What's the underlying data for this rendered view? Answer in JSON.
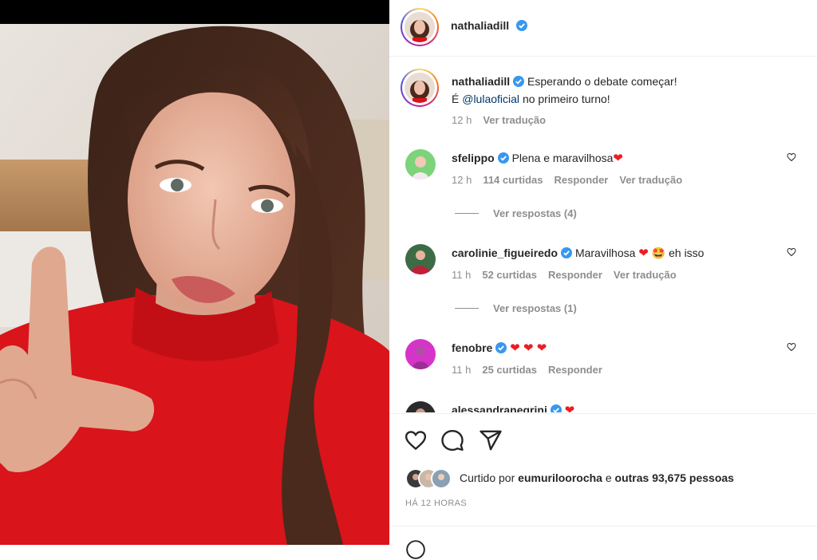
{
  "post": {
    "author": "nathaliadill",
    "caption_line1": "Esperando o debate começar!",
    "caption_prefix": "É",
    "caption_mention": "@lulaoficial",
    "caption_suffix": "no primeiro turno!",
    "caption_time": "12 h",
    "caption_translate": "Ver tradução"
  },
  "comments": [
    {
      "user": "sfelippo",
      "text": "Plena e maravilhosa",
      "emoji": "❤",
      "time": "12 h",
      "likes": "114 curtidas",
      "reply": "Responder",
      "translate": "Ver tradução",
      "replies": "Ver respostas (4)"
    },
    {
      "user": "carolinie_figueiredo",
      "text": "Maravilhosa",
      "emoji": "❤",
      "emoji2": "🤩",
      "text_after": "eh isso",
      "time": "11 h",
      "likes": "52 curtidas",
      "reply": "Responder",
      "translate": "Ver tradução",
      "replies": "Ver respostas (1)"
    },
    {
      "user": "fenobre",
      "emoji": "❤ ❤ ❤",
      "time": "11 h",
      "likes": "25 curtidas",
      "reply": "Responder"
    },
    {
      "user": "alessandranegrini",
      "emoji": "❤"
    }
  ],
  "likes": {
    "prefix": "Curtido por",
    "user": "eumuriloorocha",
    "middle": "e",
    "others": "outras 93,675 pessoas"
  },
  "posted_ago": "HÁ 12 HORAS",
  "icons": {
    "like": "heart-icon",
    "comment": "comment-icon",
    "share": "send-icon",
    "verified": "verified-badge-icon"
  },
  "colors": {
    "verified": "#3897f0",
    "heart": "#ed1c24",
    "sweater": "#d9141b"
  }
}
